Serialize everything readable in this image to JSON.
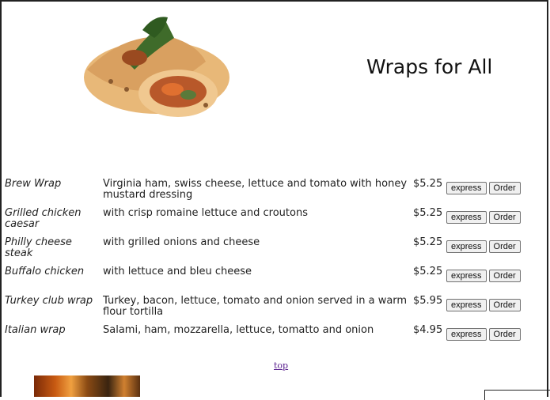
{
  "page": {
    "title": "Wraps for All",
    "top_link": "top"
  },
  "menu": {
    "express_label": "express",
    "order_label": "Order",
    "items": [
      {
        "name": "Brew Wrap",
        "description": "Virginia ham, swiss cheese, lettuce and tomato with honey mustard dressing",
        "price": "$5.25"
      },
      {
        "name": "Grilled chicken caesar",
        "description": "with crisp romaine lettuce and croutons",
        "price": "$5.25"
      },
      {
        "name": "Philly cheese steak",
        "description": "with grilled onions and cheese",
        "price": "$5.25"
      },
      {
        "name": "Buffalo chicken",
        "description": "with lettuce and bleu cheese",
        "price": "$5.25"
      },
      {
        "name": "Turkey club wrap",
        "description": "Turkey, bacon, lettuce, tomato and onion served in a warm flour tortilla",
        "price": "$5.95"
      },
      {
        "name": "Italian wrap",
        "description": "Salami, ham, mozzarella, lettuce, tomatto and onion",
        "price": "$4.95"
      }
    ]
  }
}
